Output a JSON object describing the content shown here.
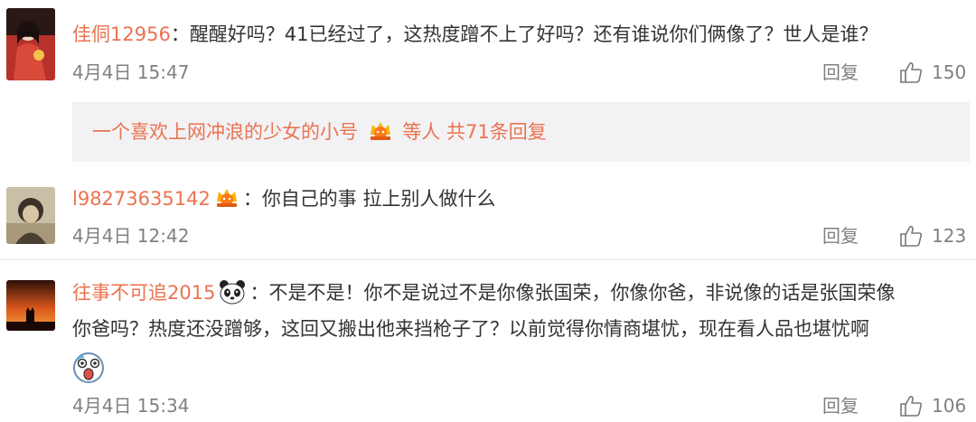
{
  "comments": [
    {
      "username": "佳侗12956",
      "colon": "：",
      "text": "醒醒好吗？41已经过了，这热度蹭不上了好吗？还有谁说你们俩像了？世人是谁？",
      "time": "4月4日 15:47",
      "reply_label": "回复",
      "likes": "150"
    },
    {
      "username": "l98273635142",
      "colon": "：",
      "text": "你自己的事 拉上别人做什么",
      "time": "4月4日 12:42",
      "reply_label": "回复",
      "likes": "123"
    },
    {
      "username": "往事不可追2015",
      "colon": "：",
      "text_line1": "不是不是！你不是说过不是你像张国荣，你像你爸，非说像的话是张国荣像",
      "text_line2": "你爸吗？热度还没蹭够，这回又搬出他来挡枪子了？以前觉得你情商堪忧，现在看人品也堪忧啊",
      "time": "4月4日 15:34",
      "reply_label": "回复",
      "likes": "106"
    }
  ],
  "subreplies": {
    "user": "一个喜欢上网冲浪的少女的小号",
    "suffix": "等人 共71条回复"
  },
  "icons": {
    "like": "thumbs-up-icon",
    "badge": "member-badge-icon",
    "panda": "panda-emoji-icon",
    "shocked": "shocked-face-emoji-icon"
  },
  "colors": {
    "username": "#eb7350",
    "meta": "#808080",
    "text": "#333333",
    "subreply_bg": "#f2f2f5"
  }
}
